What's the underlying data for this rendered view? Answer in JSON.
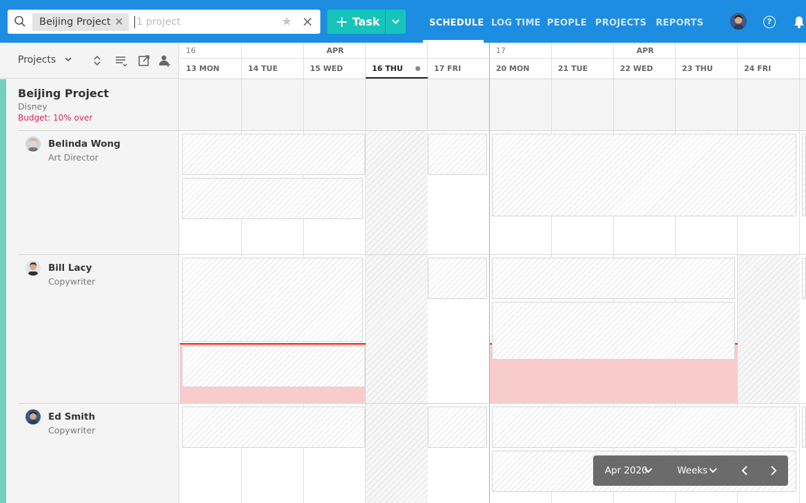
{
  "search": {
    "chip_label": "Beijing Project",
    "placeholder": "1 project"
  },
  "toolbar": {
    "task_label": "Task"
  },
  "nav": {
    "schedule": "SCHEDULE",
    "log_time": "LOG TIME",
    "people": "PEOPLE",
    "projects": "PROJECTS",
    "reports": "REPORTS"
  },
  "left": {
    "projects_dropdown": "Projects"
  },
  "calendar": {
    "weeks": [
      {
        "number": "16",
        "month": "APR"
      },
      {
        "number": "17",
        "month": "APR"
      }
    ],
    "days": [
      "13 MON",
      "14 TUE",
      "15 WED",
      "16 THU",
      "17 FRI",
      "20 MON",
      "21 TUE",
      "22 WED",
      "23 THU",
      "24 FRI"
    ],
    "today": "16 THU"
  },
  "project": {
    "name": "Beijing Project",
    "client": "Disney",
    "budget": "Budget: 10% over"
  },
  "people": [
    {
      "name": "Belinda Wong",
      "role": "Art Director"
    },
    {
      "name": "Bill Lacy",
      "role": "Copywriter"
    },
    {
      "name": "Ed Smith",
      "role": "Copywriter"
    }
  ],
  "footer": {
    "period": "Apr 2020",
    "view": "Weeks"
  },
  "colors": {
    "topbar": "#1d8de1",
    "task_button": "#17c4bb",
    "budget_over": "#e0245e",
    "overallocated": "#f9cccc"
  }
}
